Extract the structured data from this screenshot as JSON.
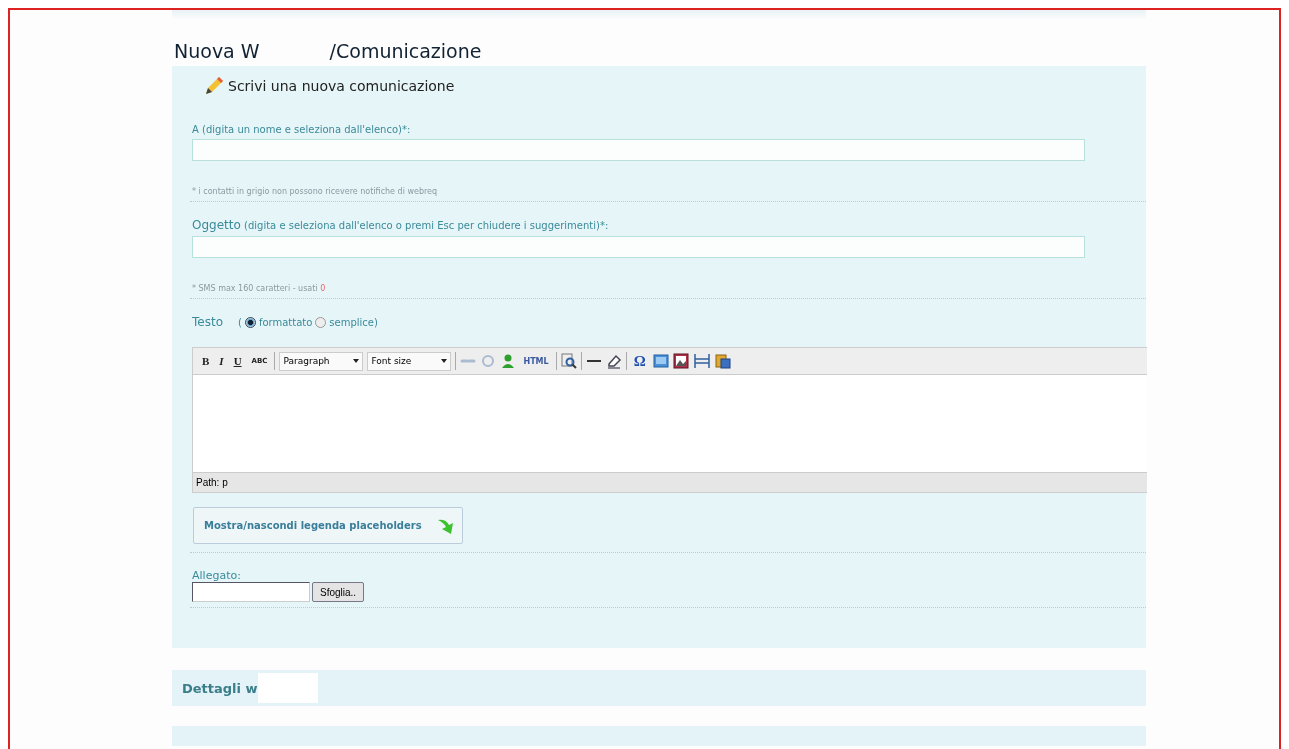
{
  "page_title": {
    "start": "Nuova W",
    "end": "/Comunicazione"
  },
  "compose": {
    "heading": "Scrivi una nuova comunicazione",
    "to": {
      "label": "A (digita un nome e seleziona dall'elenco)*:",
      "note": "* i contatti in grigio non possono ricevere notifiche di webreq"
    },
    "subject": {
      "label": "Oggetto",
      "hint": "(digita e seleziona dall'elenco o premi Esc per chiudere i suggerimenti)*:",
      "note": "* SMS max 160 caratteri - usati",
      "counter": "0"
    },
    "text_mode": {
      "label": "Testo",
      "open": "(",
      "options": [
        {
          "label": "formattato",
          "selected": true
        },
        {
          "label": "semplice)",
          "selected": false
        }
      ]
    },
    "editor": {
      "format_buttons": [
        "B",
        "I",
        "U",
        "ABC"
      ],
      "block_select": "Paragraph",
      "size_select": "Font size",
      "link_buttons_disabled": true,
      "html_button": "HTML",
      "special_char": "Ω",
      "path": "Path: p"
    },
    "legend_button": "Mostra/nascondi legenda placeholders",
    "attachment": {
      "label": "Allegato:",
      "browse": "Sfoglia.."
    }
  },
  "details": {
    "heading": "Dettagli w"
  }
}
